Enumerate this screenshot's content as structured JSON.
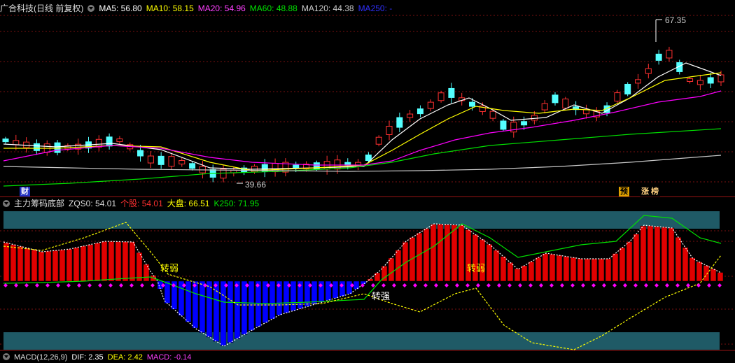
{
  "header_top": {
    "title": "广合科技(日线 前复权)",
    "ma5": "MA5: 56.80",
    "ma10": "MA10: 58.15",
    "ma20": "MA20: 54.96",
    "ma60": "MA60: 48.88",
    "ma120": "MA120: 44.38",
    "ma250": "MA250: -"
  },
  "price_labels": {
    "high": "67.35",
    "low": "39.66"
  },
  "badges": {
    "cai": "财",
    "yu": "预",
    "zhang": "涨",
    "bang": "榜"
  },
  "header_mid": {
    "title": "主力筹码底部",
    "zqs": "ZQS0: 54.01",
    "gegu": "个股: 54.01",
    "dapan": "大盘: 66.51",
    "k250": "K250: 71.95"
  },
  "annotations": {
    "weak1": "转弱",
    "strong": "转强",
    "weak2": "转弱"
  },
  "header_bottom": {
    "macd": "MACD(12,26,9)",
    "dif": "DIF: 2.35",
    "dea": "DEA: 2.42",
    "macd_val": "MACD: -0.14"
  },
  "colors": {
    "up": "#ff3030",
    "down": "#54ffff",
    "ma5": "#ffffff",
    "ma10": "#ffff00",
    "ma20": "#ff00ff",
    "ma60": "#00e000",
    "ma120": "#c8c8c8",
    "ma250": "#0000ff",
    "band": "#1f5a66",
    "bar_pos": "#e00000",
    "bar_neg": "#0000ff",
    "dots": "#ff00ff"
  }
}
